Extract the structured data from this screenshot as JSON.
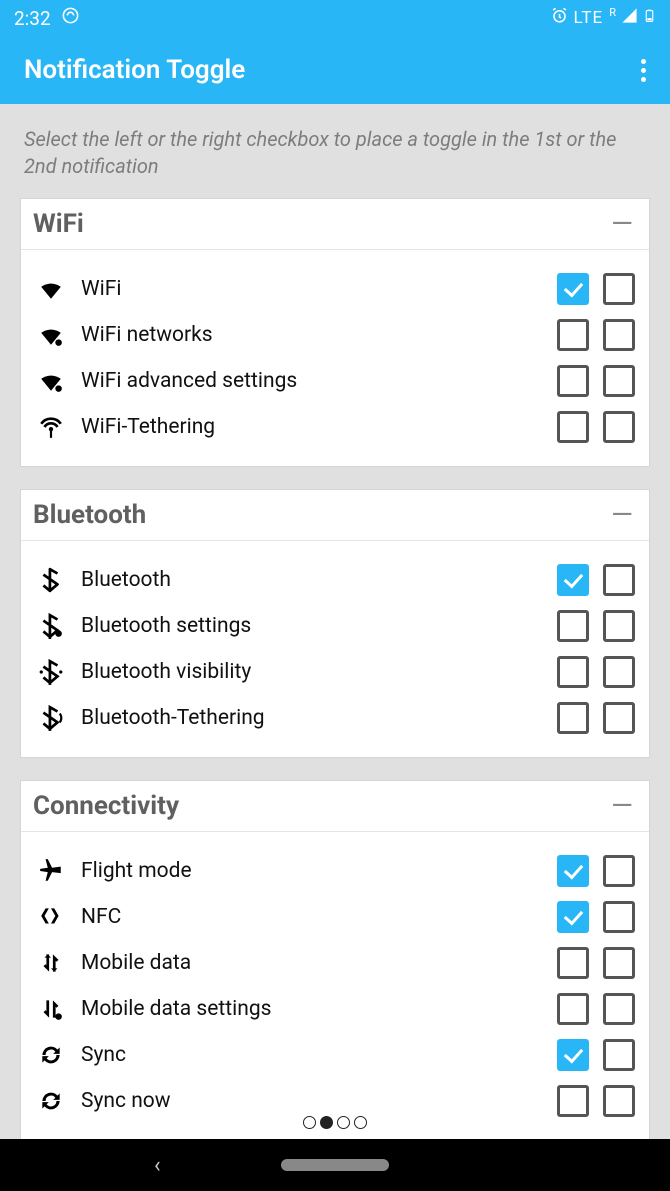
{
  "status": {
    "time": "2:32",
    "lte": "LTE",
    "roam": "R"
  },
  "app": {
    "title": "Notification Toggle"
  },
  "hint": "Select the left or the right checkbox to place a toggle in the 1st or the 2nd notification",
  "sections": [
    {
      "title": "WiFi",
      "items": [
        {
          "icon": "wifi",
          "label": "WiFi",
          "c1": true,
          "c2": false
        },
        {
          "icon": "wifi-gear",
          "label": "WiFi networks",
          "c1": false,
          "c2": false
        },
        {
          "icon": "wifi-gear",
          "label": "WiFi advanced settings",
          "c1": false,
          "c2": false
        },
        {
          "icon": "wifi-tether",
          "label": "WiFi-Tethering",
          "c1": false,
          "c2": false
        }
      ]
    },
    {
      "title": "Bluetooth",
      "items": [
        {
          "icon": "bt",
          "label": "Bluetooth",
          "c1": true,
          "c2": false
        },
        {
          "icon": "bt-gear",
          "label": "Bluetooth settings",
          "c1": false,
          "c2": false
        },
        {
          "icon": "bt-vis",
          "label": "Bluetooth visibility",
          "c1": false,
          "c2": false
        },
        {
          "icon": "bt-tether",
          "label": "Bluetooth-Tethering",
          "c1": false,
          "c2": false
        }
      ]
    },
    {
      "title": "Connectivity",
      "items": [
        {
          "icon": "plane",
          "label": "Flight mode",
          "c1": true,
          "c2": false
        },
        {
          "icon": "nfc",
          "label": "NFC",
          "c1": true,
          "c2": false
        },
        {
          "icon": "data",
          "label": "Mobile data",
          "c1": false,
          "c2": false
        },
        {
          "icon": "data-gear",
          "label": "Mobile data settings",
          "c1": false,
          "c2": false
        },
        {
          "icon": "sync",
          "label": "Sync",
          "c1": true,
          "c2": false
        },
        {
          "icon": "sync",
          "label": "Sync now",
          "c1": false,
          "c2": false
        }
      ]
    }
  ]
}
